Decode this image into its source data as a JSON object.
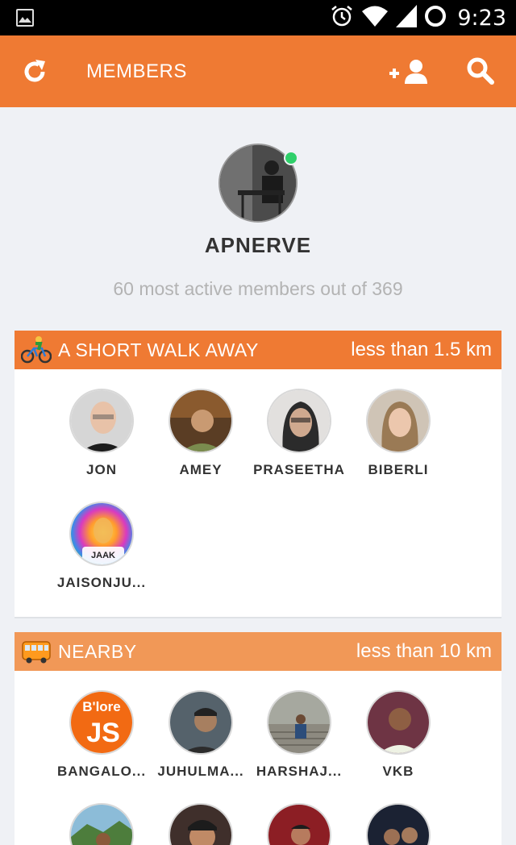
{
  "status_bar": {
    "time": "9:23"
  },
  "toolbar": {
    "title": "MEMBERS",
    "refresh_icon": "refresh-icon",
    "add_member_icon": "add-user-icon",
    "search_icon": "search-icon"
  },
  "profile": {
    "name": "APNERVE",
    "online": true,
    "summary": "60 most active members out of 369"
  },
  "sections": [
    {
      "title": "A SHORT WALK AWAY",
      "distance": "less than 1.5 km",
      "icon": "bicyclist-icon",
      "header_color": "#ef7a33",
      "members": [
        {
          "name": "JON",
          "avatar_color": "#c9c9c9"
        },
        {
          "name": "AMEY",
          "avatar_color": "#6b4a2c"
        },
        {
          "name": "PRASEETHA",
          "avatar_color": "#d8d6d3"
        },
        {
          "name": "BIBERLI",
          "avatar_color": "#b9a48d"
        },
        {
          "name": "JAISONJU...",
          "avatar_color": "#9bd14a",
          "avatar_text": "JAAK"
        }
      ]
    },
    {
      "title": "NEARBY",
      "distance": "less than 10 km",
      "icon": "bus-icon",
      "header_color": "#f19857",
      "members": [
        {
          "name": "BANGALO...",
          "avatar_color": "#f26a13",
          "avatar_text": "B'lore JS"
        },
        {
          "name": "JUHULMA...",
          "avatar_color": "#3b4a55"
        },
        {
          "name": "HARSHAJ...",
          "avatar_color": "#8a8f86"
        },
        {
          "name": "VKB",
          "avatar_color": "#7b4150"
        },
        {
          "name": "",
          "avatar_color": "#6aa3c4"
        },
        {
          "name": "",
          "avatar_color": "#4a3a36"
        },
        {
          "name": "",
          "avatar_color": "#8c1e24"
        },
        {
          "name": "",
          "avatar_color": "#1f2a3c"
        }
      ]
    }
  ]
}
